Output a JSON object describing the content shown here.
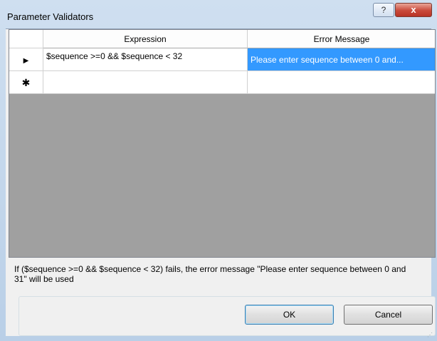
{
  "window": {
    "title": "Parameter Validators",
    "help_label": "?",
    "close_label": "x"
  },
  "grid": {
    "columns": [
      "Expression",
      "Error Message"
    ],
    "rows": [
      {
        "indicator": "▶",
        "expression": "$sequence >=0 && $sequence < 32",
        "error_message": "Please enter sequence between 0 and..."
      }
    ],
    "new_row_indicator": "✱"
  },
  "info_text": "If ($sequence >=0 && $sequence < 32) fails, the error message \"Please enter sequence between 0 and 31\" will be used",
  "buttons": {
    "ok": "OK",
    "cancel": "Cancel"
  },
  "colors": {
    "selection": "#3399ff",
    "grid_background": "#a0a0a0"
  }
}
